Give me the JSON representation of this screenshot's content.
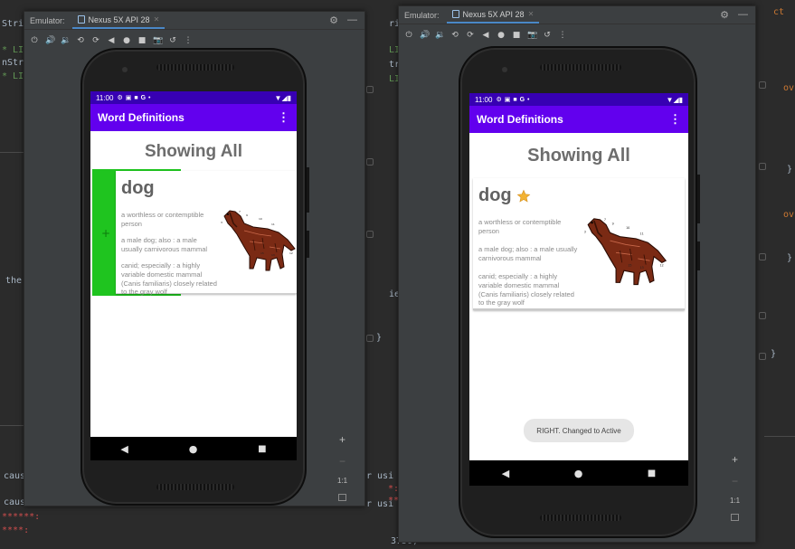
{
  "ide": {
    "fragments": [
      {
        "id": "f1",
        "text": "Stri",
        "color": "#a9b7c6"
      },
      {
        "id": "f2",
        "text": "* LI",
        "color": "#629755"
      },
      {
        "id": "f3",
        "text": "nStr",
        "color": "#a9b7c6"
      },
      {
        "id": "f4",
        "text": "* LI",
        "color": "#629755"
      },
      {
        "id": "f5",
        "text": "the",
        "color": "#a9b7c6"
      },
      {
        "id": "f6",
        "text": "caus",
        "color": "#a9b7c6"
      },
      {
        "id": "f7",
        "text": "caus",
        "color": "#a9b7c6"
      },
      {
        "id": "f8",
        "text": "******:",
        "color": "#cc4d4d"
      },
      {
        "id": "f9",
        "text": "****:",
        "color": "#cc4d4d"
      },
      {
        "id": "f10",
        "text": "ri",
        "color": "#a9b7c6"
      },
      {
        "id": "f11",
        "text": "LI",
        "color": "#629755"
      },
      {
        "id": "f12",
        "text": "tr",
        "color": "#a9b7c6"
      },
      {
        "id": "f13",
        "text": "LI",
        "color": "#629755"
      },
      {
        "id": "f14",
        "text": "ie",
        "color": "#a9b7c6"
      },
      {
        "id": "f15",
        "text": "}",
        "color": "#a9b7c6"
      },
      {
        "id": "f16",
        "text": "r usi",
        "color": "#a9b7c6"
      },
      {
        "id": "f17",
        "text": "*:",
        "color": "#cc4d4d"
      },
      {
        "id": "f18",
        "text": "r usi",
        "color": "#a9b7c6"
      },
      {
        "id": "f19",
        "text": "**",
        "color": "#cc4d4d"
      },
      {
        "id": "f20",
        "text": "3750)",
        "color": "#a9b7c6"
      },
      {
        "id": "f21",
        "text": "ct",
        "color": "#cc7832"
      },
      {
        "id": "f22",
        "text": "ov",
        "color": "#cc7832"
      },
      {
        "id": "f23",
        "text": "}",
        "color": "#a9b7c6"
      },
      {
        "id": "f24",
        "text": "ov",
        "color": "#cc7832"
      },
      {
        "id": "f25",
        "text": "}",
        "color": "#a9b7c6"
      },
      {
        "id": "f26",
        "text": "}",
        "color": "#a9b7c6"
      }
    ]
  },
  "emulators": [
    {
      "title_label": "Emulator:",
      "device_tab": "Nexus 5X API 28",
      "zoom_plus": "+",
      "zoom_minus": "−",
      "zoom_ratio": "1:1",
      "status_time": "11:00",
      "app_title": "Word Definitions",
      "heading": "Showing All",
      "card": {
        "word": "dog",
        "definitions": [
          "a worthless or contemptible person",
          "a male dog; also : a male usually carnivorous mammal",
          "canid; especially : a highly variable domestic mammal (Canis familiaris) closely related to the gray wolf"
        ],
        "swipe_icon": "+",
        "swipe_color": "#1fc41f",
        "swipe_progress_percent": 65
      },
      "nav_back": "◀",
      "nav_home": "●",
      "nav_recent": "■"
    },
    {
      "title_label": "Emulator:",
      "device_tab": "Nexus 5X API 28",
      "zoom_plus": "+",
      "zoom_minus": "−",
      "zoom_ratio": "1:1",
      "status_time": "11:00",
      "app_title": "Word Definitions",
      "heading": "Showing All",
      "card": {
        "word": "dog",
        "star_color": "#f2b233",
        "definitions": [
          "a worthless or contemptible person",
          "a male dog; also : a male usually carnivorous mammal",
          "canid; especially : a highly variable domestic mammal (Canis familiaris) closely related to the gray wolf"
        ]
      },
      "toast": "RIGHT. Changed to Active",
      "nav_back": "◀",
      "nav_home": "●",
      "nav_recent": "■"
    }
  ],
  "colors": {
    "status_bar": "#3700b3",
    "app_bar": "#6200ee",
    "ide_background": "#2b2b2b"
  }
}
